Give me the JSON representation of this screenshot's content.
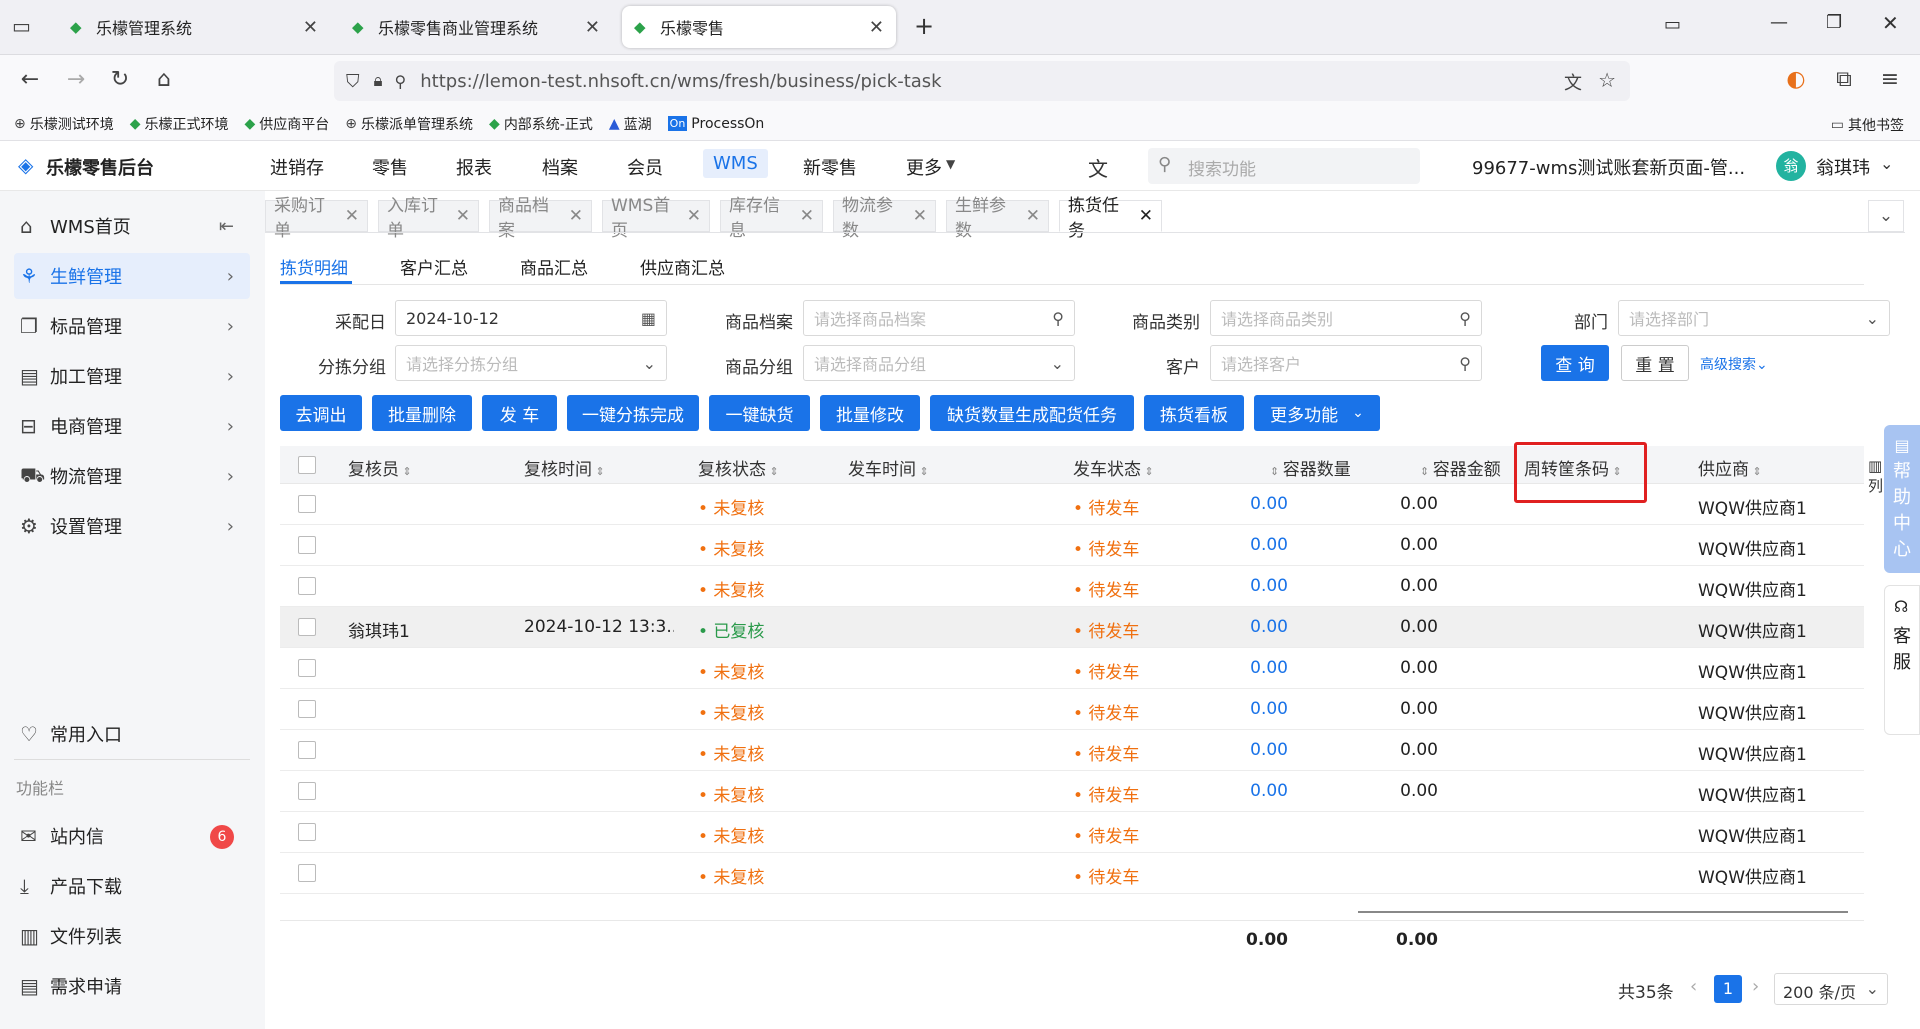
{
  "browser": {
    "tabs": [
      {
        "title": "乐檬管理系统"
      },
      {
        "title": "乐檬零售商业管理系统"
      },
      {
        "title": "乐檬零售"
      }
    ],
    "url": "https://lemon-test.nhsoft.cn/wms/fresh/business/pick-task",
    "bookmarks": [
      "乐檬测试环境",
      "乐檬正式环境",
      "供应商平台",
      "乐檬派单管理系统",
      "内部系统-正式",
      "蓝湖",
      "ProcessOn"
    ],
    "other_bookmarks": "其他书签"
  },
  "app": {
    "logo": "乐檬零售后台",
    "menu": [
      "进销存",
      "零售",
      "报表",
      "档案",
      "会员",
      "WMS",
      "新零售",
      "更多"
    ],
    "active_menu": "WMS",
    "search_placeholder": "搜索功能",
    "account": "99677-wms测试账套新页面-管...",
    "avatar_text": "翁",
    "user": "翁琪玮"
  },
  "sidebar": {
    "items": [
      "WMS首页",
      "生鲜管理",
      "标品管理",
      "加工管理",
      "电商管理",
      "物流管理",
      "设置管理"
    ],
    "active": "生鲜管理",
    "bottom": [
      "常用入口"
    ],
    "section_label": "功能栏",
    "tools": [
      "站内信",
      "产品下载",
      "文件列表",
      "需求申请"
    ],
    "message_badge": "6"
  },
  "page_tabs": [
    "采购订单",
    "入库订单",
    "商品档案",
    "WMS首页",
    "库存信息",
    "物流参数",
    "生鲜参数",
    "拣货任务"
  ],
  "active_page_tab": "拣货任务",
  "sub_tabs": [
    "拣货明细",
    "客户汇总",
    "商品汇总",
    "供应商汇总"
  ],
  "filters": {
    "date_label": "采配日",
    "date_value": "2024-10-12",
    "goods_label": "商品档案",
    "goods_placeholder": "请选择商品档案",
    "category_label": "商品类别",
    "category_placeholder": "请选择商品类别",
    "dept_label": "部门",
    "dept_placeholder": "请选择部门",
    "group_label": "分拣分组",
    "group_placeholder": "请选择分拣分组",
    "goods_group_label": "商品分组",
    "goods_group_placeholder": "请选择商品分组",
    "customer_label": "客户",
    "customer_placeholder": "请选择客户",
    "query_btn": "查 询",
    "reset_btn": "重 置",
    "advanced": "高级搜索"
  },
  "actions": [
    "去调出",
    "批量删除",
    "发 车",
    "一键分拣完成",
    "一键缺货",
    "批量修改",
    "缺货数量生成配货任务",
    "拣货看板",
    "更多功能"
  ],
  "table": {
    "columns": [
      "复核员",
      "复核时间",
      "复核状态",
      "发车时间",
      "发车状态",
      "容器数量",
      "容器金额",
      "周转筐条码",
      "供应商"
    ],
    "column_setting": "列",
    "rows": [
      {
        "reviewer": "",
        "review_time": "",
        "review_status": "未复核",
        "depart_time": "",
        "depart_status": "待发车",
        "container_qty": "0.00",
        "container_amt": "0.00",
        "supplier": "WQW供应商1"
      },
      {
        "reviewer": "",
        "review_time": "",
        "review_status": "未复核",
        "depart_time": "",
        "depart_status": "待发车",
        "container_qty": "0.00",
        "container_amt": "0.00",
        "supplier": "WQW供应商1"
      },
      {
        "reviewer": "",
        "review_time": "",
        "review_status": "未复核",
        "depart_time": "",
        "depart_status": "待发车",
        "container_qty": "0.00",
        "container_amt": "0.00",
        "supplier": "WQW供应商1"
      },
      {
        "reviewer": "翁琪玮1",
        "review_time": "2024-10-12 13:3...",
        "review_status": "已复核",
        "depart_time": "",
        "depart_status": "待发车",
        "container_qty": "0.00",
        "container_amt": "0.00",
        "supplier": "WQW供应商1"
      },
      {
        "reviewer": "",
        "review_time": "",
        "review_status": "未复核",
        "depart_time": "",
        "depart_status": "待发车",
        "container_qty": "0.00",
        "container_amt": "0.00",
        "supplier": "WQW供应商1"
      },
      {
        "reviewer": "",
        "review_time": "",
        "review_status": "未复核",
        "depart_time": "",
        "depart_status": "待发车",
        "container_qty": "0.00",
        "container_amt": "0.00",
        "supplier": "WQW供应商1"
      },
      {
        "reviewer": "",
        "review_time": "",
        "review_status": "未复核",
        "depart_time": "",
        "depart_status": "待发车",
        "container_qty": "0.00",
        "container_amt": "0.00",
        "supplier": "WQW供应商1"
      },
      {
        "reviewer": "",
        "review_time": "",
        "review_status": "未复核",
        "depart_time": "",
        "depart_status": "待发车",
        "container_qty": "0.00",
        "container_amt": "0.00",
        "supplier": "WQW供应商1"
      },
      {
        "reviewer": "",
        "review_time": "",
        "review_status": "未复核",
        "depart_time": "",
        "depart_status": "待发车",
        "container_qty": "",
        "container_amt": "",
        "supplier": "WQW供应商1"
      },
      {
        "reviewer": "",
        "review_time": "",
        "review_status": "未复核",
        "depart_time": "",
        "depart_status": "待发车",
        "container_qty": "",
        "container_amt": "",
        "supplier": "WQW供应商1"
      }
    ],
    "totals": {
      "container_qty": "0.00",
      "container_amt": "0.00"
    }
  },
  "pagination": {
    "total": "共35条",
    "current": "1",
    "page_size": "200 条/页"
  },
  "floating": {
    "help": [
      "帮",
      "助",
      "中",
      "心"
    ],
    "service": [
      "客",
      "服"
    ]
  },
  "colors": {
    "primary": "#1a73e8",
    "pending": "#f07010",
    "done": "#2a9a4a",
    "highlight": "#e02020"
  }
}
